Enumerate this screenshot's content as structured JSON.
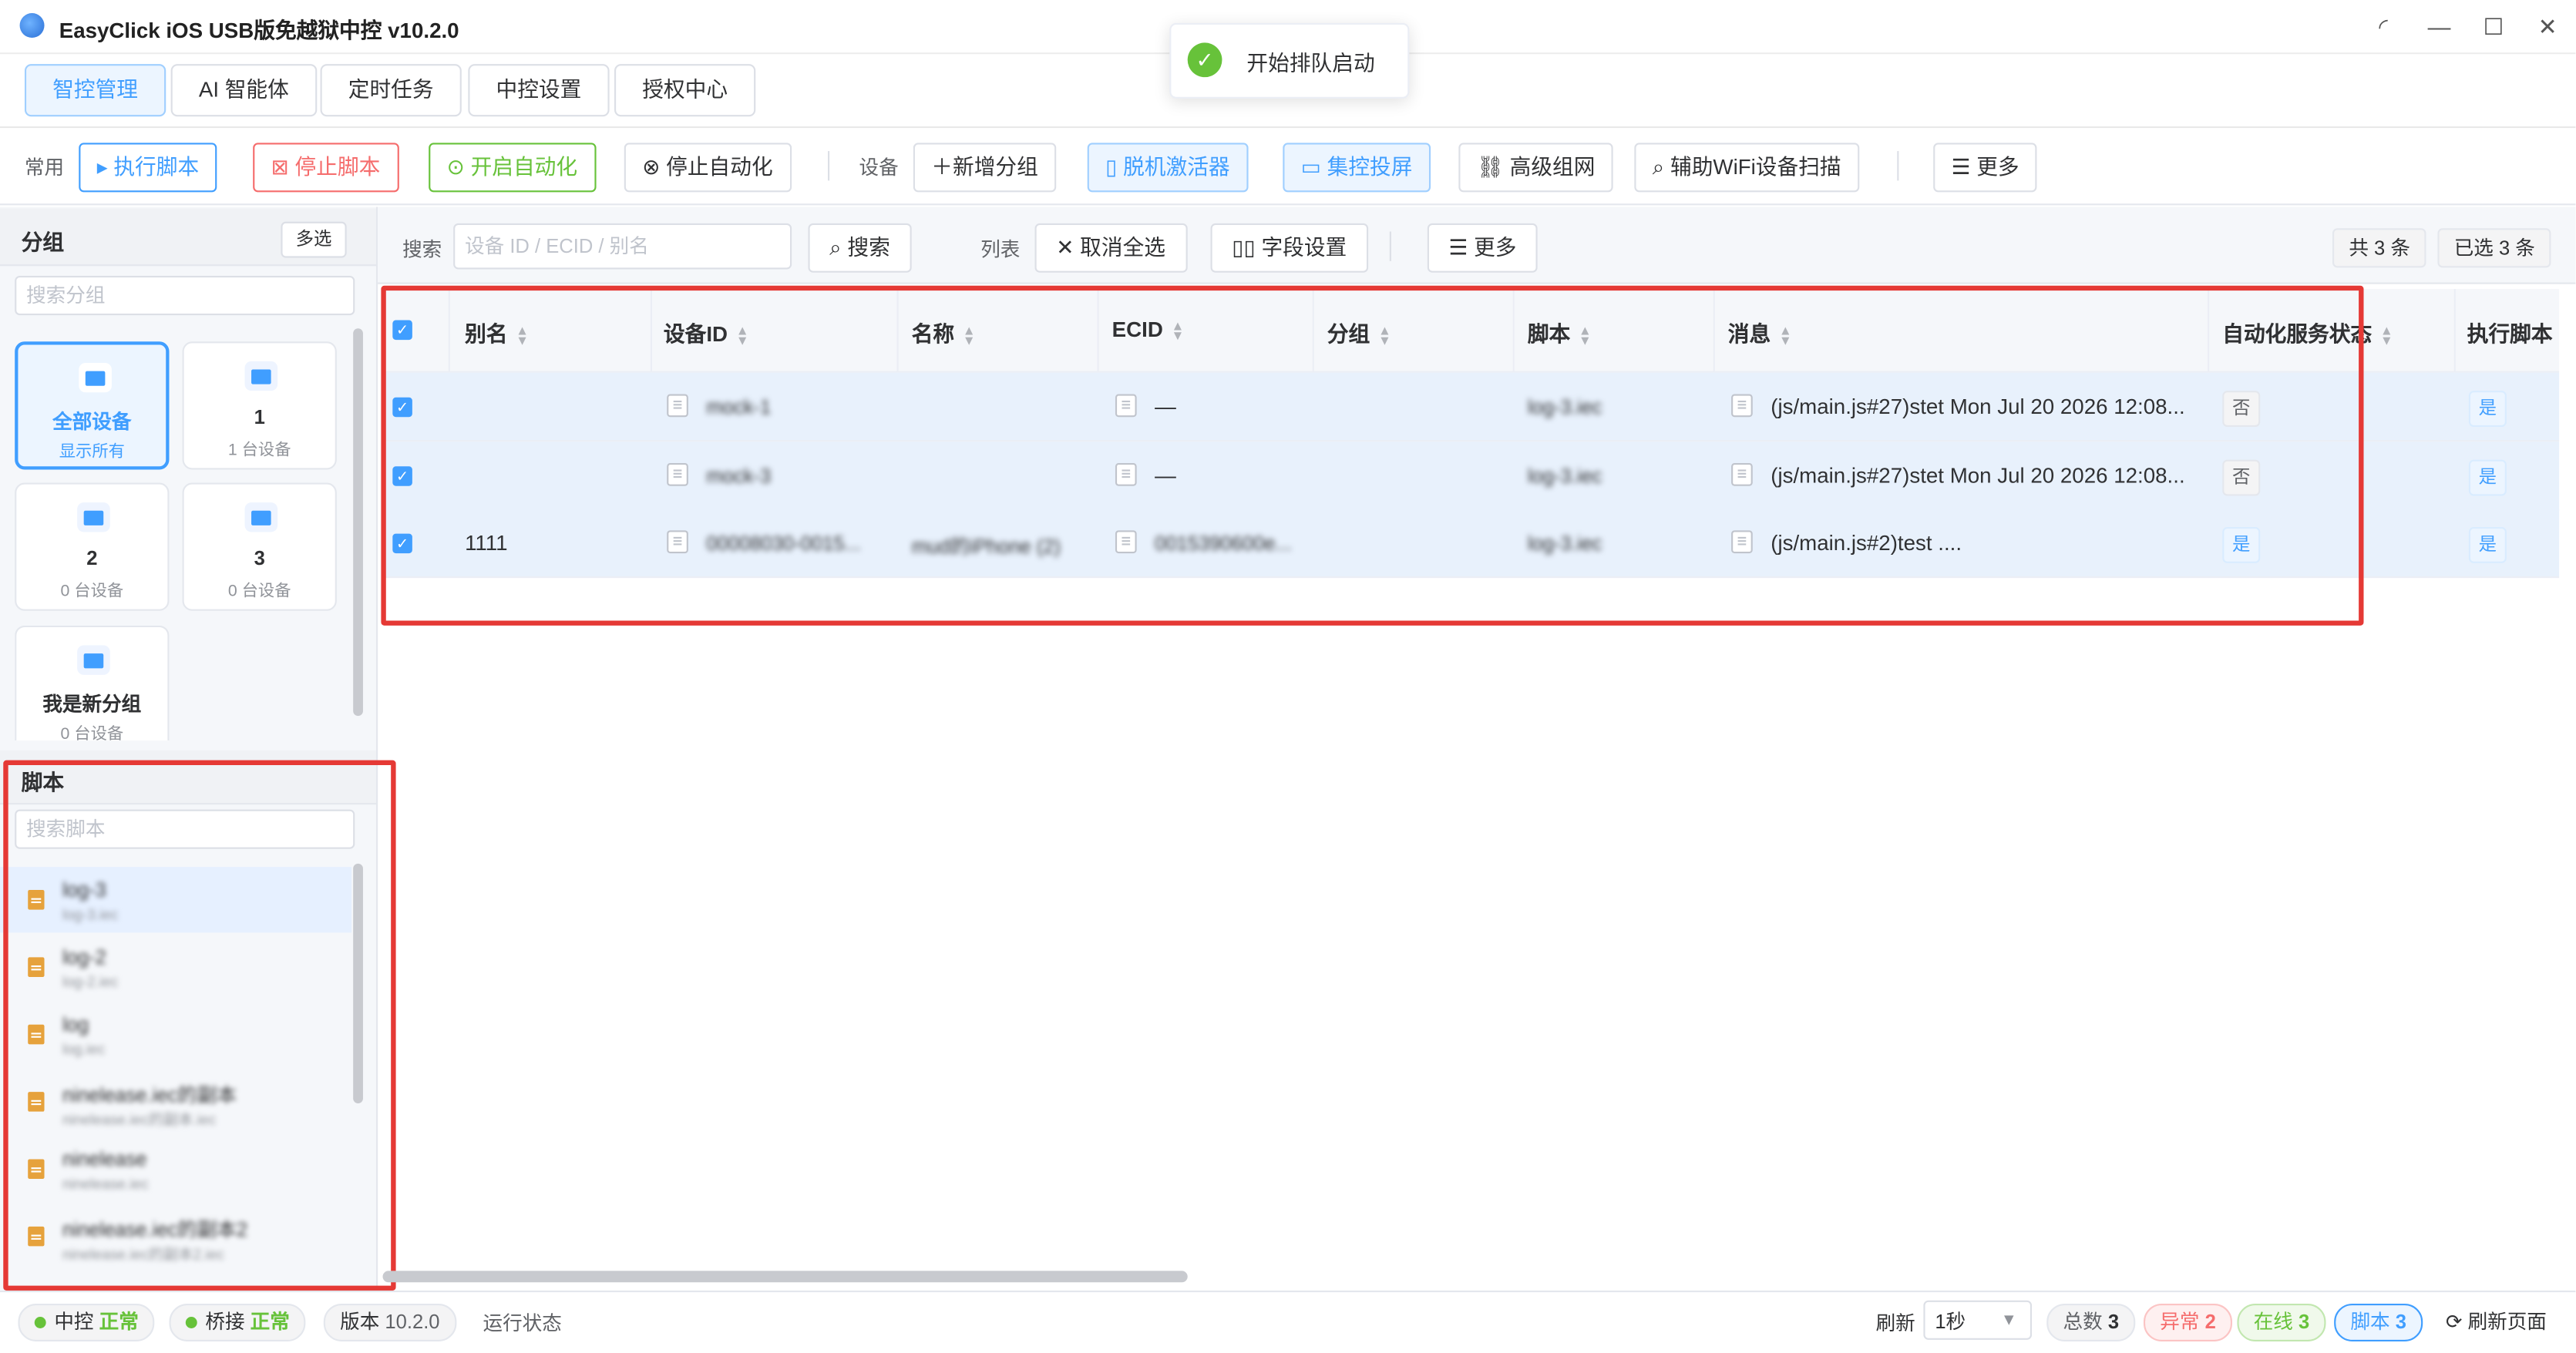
{
  "window": {
    "title": "EasyClick iOS USB版免越狱中控 v10.2.0",
    "controls": [
      "minimize-icon",
      "maximize-icon",
      "close-icon"
    ]
  },
  "nav": {
    "tabs": [
      {
        "label": "智控管理",
        "active": true
      },
      {
        "label": "AI 智能体",
        "active": false
      },
      {
        "label": "定时任务",
        "active": false
      },
      {
        "label": "中控设置",
        "active": false
      },
      {
        "label": "授权中心",
        "active": false
      }
    ]
  },
  "toast": {
    "message": "开始排队启动"
  },
  "toolbar": {
    "common_label": "常用",
    "run_script": "执行脚本",
    "stop_script": "停止脚本",
    "start_auto": "开启自动化",
    "stop_auto": "停止自动化",
    "device_label": "设备",
    "add_group": "新增分组",
    "offline_activator": "脱机激活器",
    "screen_control": "集控投屏",
    "advanced_network": "高级组网",
    "wifi_scan": "辅助WiFi设备扫描",
    "more": "更多"
  },
  "groups": {
    "title": "分组",
    "multi_select": "多选",
    "search_placeholder": "搜索分组",
    "cards": [
      {
        "name": "全部设备",
        "sub": "显示所有"
      },
      {
        "name": "1",
        "sub": "1 台设备"
      },
      {
        "name": "2",
        "sub": "0 台设备"
      },
      {
        "name": "3",
        "sub": "0 台设备"
      },
      {
        "name": "我是新分组",
        "sub": "0 台设备"
      }
    ]
  },
  "scripts": {
    "title": "脚本",
    "search_placeholder": "搜索脚本",
    "items": [
      {
        "name": "log-3",
        "file": "log-3.iec"
      },
      {
        "name": "log-2",
        "file": "log-2.iec"
      },
      {
        "name": "log",
        "file": "log.iec"
      },
      {
        "name": "ninelease.iec的副本",
        "file": "ninelease.iec的副本.iec"
      },
      {
        "name": "ninelease",
        "file": "ninelease.iec"
      },
      {
        "name": "ninelease.iec的副本2",
        "file": "ninelease.iec的副本2.iec"
      }
    ]
  },
  "main_toolbar": {
    "search_label": "搜索",
    "search_placeholder": "设备 ID / ECID / 别名",
    "search_button": "搜索",
    "list_label": "列表",
    "deselect_all": "取消全选",
    "field_settings": "字段设置",
    "more": "更多",
    "total": "共 3 条",
    "selected": "已选 3 条"
  },
  "table": {
    "columns": [
      "别名",
      "设备ID",
      "名称",
      "ECID",
      "分组",
      "脚本",
      "消息",
      "自动化服务状态",
      "执行脚本"
    ],
    "rows": [
      {
        "alias": "",
        "device_id": "mock-1",
        "name": "",
        "ecid": "—",
        "group": "",
        "script": "log-3.iec",
        "message": "(js/main.js#27)stet Mon Jul 20 2026 12:08...",
        "auto": "否",
        "exec": "是"
      },
      {
        "alias": "",
        "device_id": "mock-3",
        "name": "",
        "ecid": "—",
        "group": "",
        "script": "log-3.iec",
        "message": "(js/main.js#27)stet Mon Jul 20 2026 12:08...",
        "auto": "否",
        "exec": "是"
      },
      {
        "alias": "1111",
        "device_id": "00008030-0015...",
        "name": "mud的iPhone (2)",
        "ecid": "0015390600e...",
        "group": "",
        "script": "log-3.iec",
        "message": "(js/main.js#2)test ....",
        "auto": "是",
        "exec": "是"
      }
    ]
  },
  "status": {
    "central_label": "中控",
    "central_value": "正常",
    "bridge_label": "桥接",
    "bridge_value": "正常",
    "version_label": "版本",
    "version_value": "10.2.0",
    "run_state": "运行状态",
    "refresh_label": "刷新",
    "refresh_value": "1秒",
    "total_label": "总数",
    "total_value": "3",
    "error_label": "异常",
    "error_value": "2",
    "online_label": "在线",
    "online_value": "3",
    "script_label": "脚本",
    "script_value": "3",
    "refresh_page": "刷新页面"
  }
}
